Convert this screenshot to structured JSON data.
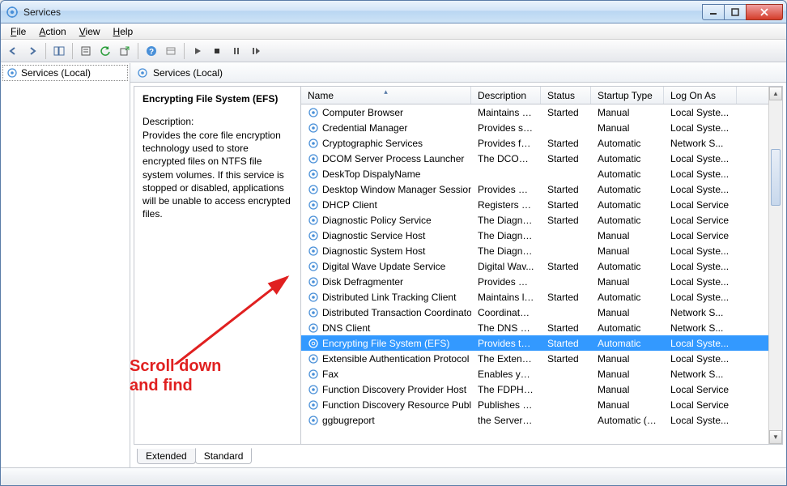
{
  "window": {
    "title": "Services"
  },
  "menu": {
    "file": "File",
    "action": "Action",
    "view": "View",
    "help": "Help"
  },
  "tree": {
    "root": "Services (Local)"
  },
  "right_header": "Services (Local)",
  "detail": {
    "name": "Encrypting File System (EFS)",
    "desc_label": "Description:",
    "desc": "Provides the core file encryption technology used to store encrypted files on NTFS file system volumes. If this service is stopped or disabled, applications will be unable to access encrypted files."
  },
  "columns": {
    "name": "Name",
    "desc": "Description",
    "status": "Status",
    "startup": "Startup Type",
    "logon": "Log On As"
  },
  "rows": [
    {
      "name": "Computer Browser",
      "desc": "Maintains a...",
      "status": "Started",
      "startup": "Manual",
      "logon": "Local Syste..."
    },
    {
      "name": "Credential Manager",
      "desc": "Provides se...",
      "status": "",
      "startup": "Manual",
      "logon": "Local Syste..."
    },
    {
      "name": "Cryptographic Services",
      "desc": "Provides fo...",
      "status": "Started",
      "startup": "Automatic",
      "logon": "Network S..."
    },
    {
      "name": "DCOM Server Process Launcher",
      "desc": "The DCOM...",
      "status": "Started",
      "startup": "Automatic",
      "logon": "Local Syste..."
    },
    {
      "name": "DeskTop DispalyName",
      "desc": "",
      "status": "",
      "startup": "Automatic",
      "logon": "Local Syste..."
    },
    {
      "name": "Desktop Window Manager Session...",
      "desc": "Provides De...",
      "status": "Started",
      "startup": "Automatic",
      "logon": "Local Syste..."
    },
    {
      "name": "DHCP Client",
      "desc": "Registers an...",
      "status": "Started",
      "startup": "Automatic",
      "logon": "Local Service"
    },
    {
      "name": "Diagnostic Policy Service",
      "desc": "The Diagno...",
      "status": "Started",
      "startup": "Automatic",
      "logon": "Local Service"
    },
    {
      "name": "Diagnostic Service Host",
      "desc": "The Diagno...",
      "status": "",
      "startup": "Manual",
      "logon": "Local Service"
    },
    {
      "name": "Diagnostic System Host",
      "desc": "The Diagno...",
      "status": "",
      "startup": "Manual",
      "logon": "Local Syste..."
    },
    {
      "name": "Digital Wave Update Service",
      "desc": "Digital Wav...",
      "status": "Started",
      "startup": "Automatic",
      "logon": "Local Syste..."
    },
    {
      "name": "Disk Defragmenter",
      "desc": "Provides Dis...",
      "status": "",
      "startup": "Manual",
      "logon": "Local Syste..."
    },
    {
      "name": "Distributed Link Tracking Client",
      "desc": "Maintains li...",
      "status": "Started",
      "startup": "Automatic",
      "logon": "Local Syste..."
    },
    {
      "name": "Distributed Transaction Coordinator",
      "desc": "Coordinates...",
      "status": "",
      "startup": "Manual",
      "logon": "Network S..."
    },
    {
      "name": "DNS Client",
      "desc": "The DNS Cli...",
      "status": "Started",
      "startup": "Automatic",
      "logon": "Network S..."
    },
    {
      "name": "Encrypting File System (EFS)",
      "desc": "Provides th...",
      "status": "Started",
      "startup": "Automatic",
      "logon": "Local Syste...",
      "selected": true
    },
    {
      "name": "Extensible Authentication Protocol",
      "desc": "The Extensi...",
      "status": "Started",
      "startup": "Manual",
      "logon": "Local Syste..."
    },
    {
      "name": "Fax",
      "desc": "Enables you...",
      "status": "",
      "startup": "Manual",
      "logon": "Network S..."
    },
    {
      "name": "Function Discovery Provider Host",
      "desc": "The FDPHO...",
      "status": "",
      "startup": "Manual",
      "logon": "Local Service"
    },
    {
      "name": "Function Discovery Resource Publi...",
      "desc": "Publishes th...",
      "status": "",
      "startup": "Manual",
      "logon": "Local Service"
    },
    {
      "name": "ggbugreport",
      "desc": "the Server is...",
      "status": "",
      "startup": "Automatic (D...",
      "logon": "Local Syste..."
    }
  ],
  "tabs": {
    "extended": "Extended",
    "standard": "Standard"
  },
  "annotation": {
    "line1": "Scroll down",
    "line2": "and find"
  }
}
